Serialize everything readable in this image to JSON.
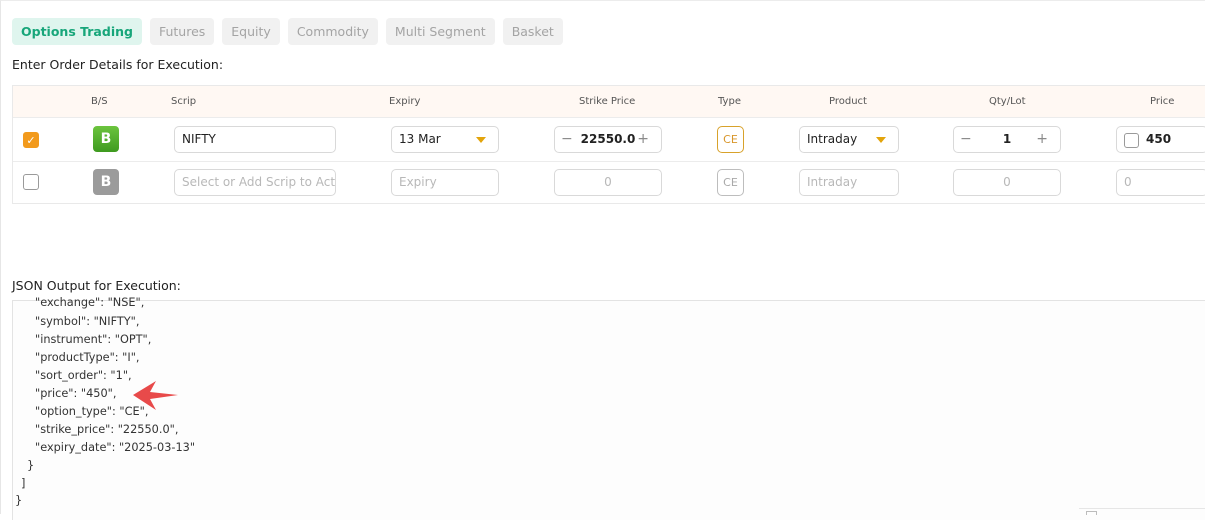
{
  "tabs": [
    {
      "label": "Options Trading",
      "active": true
    },
    {
      "label": "Futures"
    },
    {
      "label": "Equity"
    },
    {
      "label": "Commodity"
    },
    {
      "label": "Multi Segment"
    },
    {
      "label": "Basket"
    }
  ],
  "order_section_label": "Enter Order Details for Execution:",
  "table": {
    "headers": [
      "B/S",
      "Scrip",
      "Expiry",
      "Strike Price",
      "Type",
      "Product",
      "Qty/Lot",
      "Price"
    ],
    "rows": [
      {
        "checked": true,
        "check_glyph": "✓",
        "bs": "B",
        "scrip": "NIFTY",
        "expiry": "13 Mar",
        "strike_minus": "−",
        "strike": "22550.0",
        "strike_plus": "+",
        "type": "CE",
        "product": "Intraday",
        "qty_minus": "−",
        "qty": "1",
        "qty_plus": "+",
        "price": "450"
      },
      {
        "checked": false,
        "bs": "B",
        "scrip_placeholder": "Select or Add Scrip to Activate",
        "expiry_placeholder": "Expiry",
        "strike": "0",
        "type": "CE",
        "product_placeholder": "Intraday",
        "qty": "0",
        "price": "0"
      }
    ]
  },
  "json_section_label": "JSON Output for Execution:",
  "json_lines": [
    "\"exchange\": \"NSE\",",
    "\"symbol\": \"NIFTY\",",
    "\"instrument\": \"OPT\",",
    "\"productType\": \"I\",",
    "\"sort_order\": \"1\",",
    "\"price\": \"450\",",
    "\"option_type\": \"CE\",",
    "\"strike_price\": \"22550.0\",",
    "\"expiry_date\": \"2025-03-13\"",
    "}",
    "]",
    "}"
  ],
  "colors": {
    "accent_green": "#17a67a",
    "buy_green": "#4caf2a",
    "checkbox_orange": "#f29a1c",
    "dropdown_caret": "#e3a40b",
    "annotation_arrow": "#e84a4a"
  }
}
